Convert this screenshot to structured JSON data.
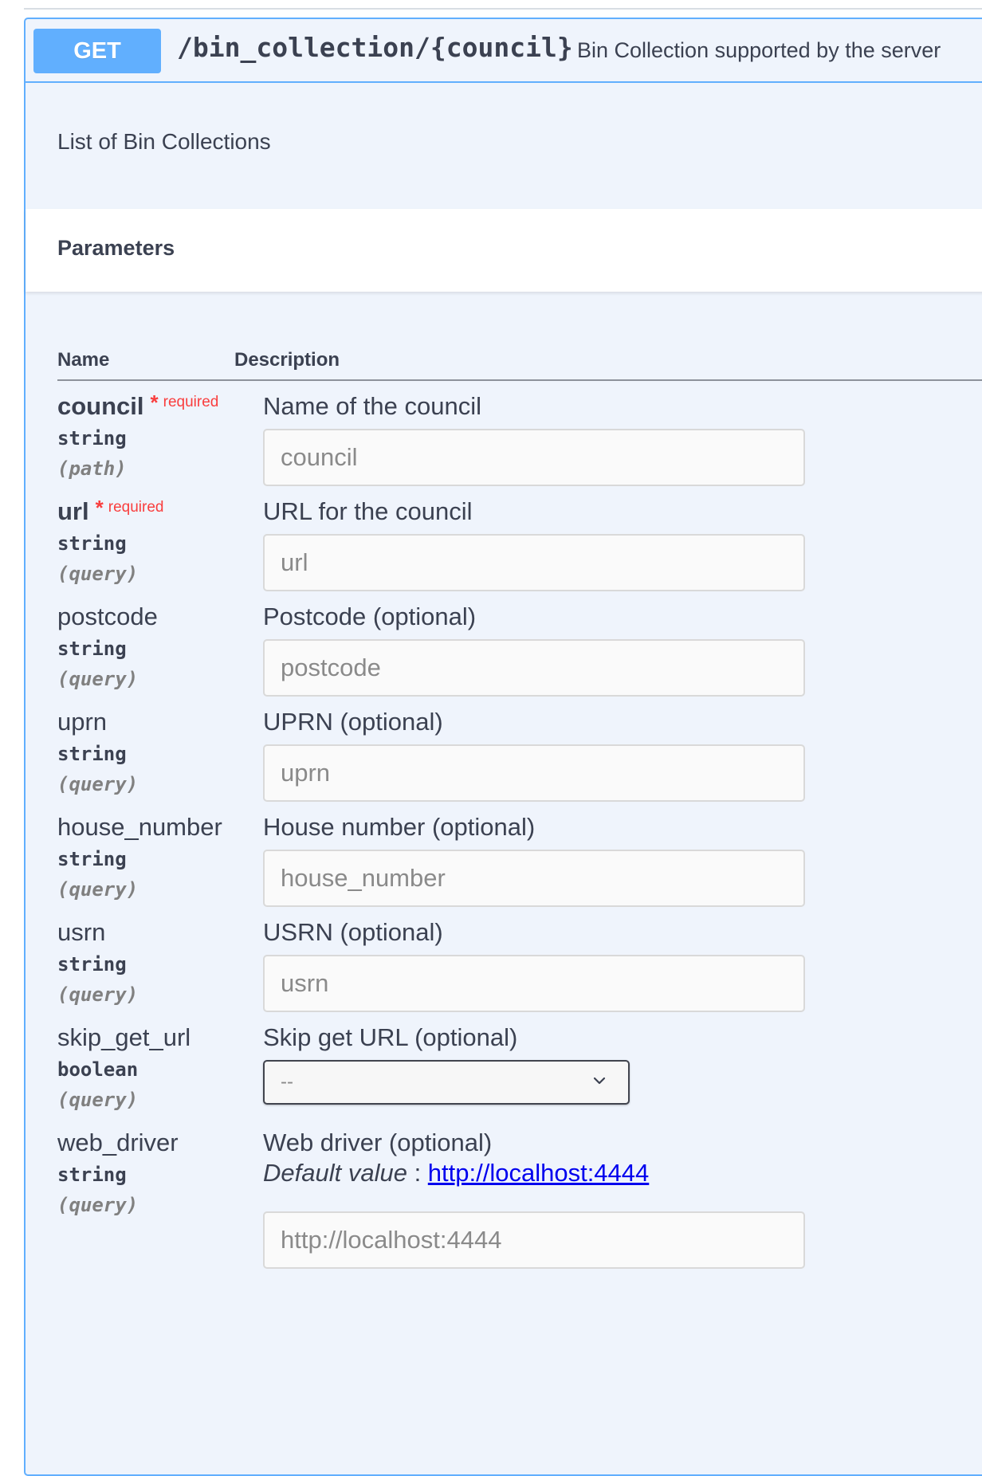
{
  "operation": {
    "method": "GET",
    "path": "/bin_collection/{council}",
    "summary": "Bin Collection supported by the server",
    "description": "List of Bin Collections"
  },
  "parameters_section": {
    "title": "Parameters",
    "col_name": "Name",
    "col_description": "Description"
  },
  "params": [
    {
      "name": "council",
      "required_label": "required",
      "type": "string",
      "in": "(path)",
      "description": "Name of the council",
      "placeholder": "council"
    },
    {
      "name": "url",
      "required_label": "required",
      "type": "string",
      "in": "(query)",
      "description": "URL for the council",
      "placeholder": "url"
    },
    {
      "name": "postcode",
      "type": "string",
      "in": "(query)",
      "description": "Postcode (optional)",
      "placeholder": "postcode"
    },
    {
      "name": "uprn",
      "type": "string",
      "in": "(query)",
      "description": "UPRN (optional)",
      "placeholder": "uprn"
    },
    {
      "name": "house_number",
      "type": "string",
      "in": "(query)",
      "description": "House number (optional)",
      "placeholder": "house_number"
    },
    {
      "name": "usrn",
      "type": "string",
      "in": "(query)",
      "description": "USRN (optional)",
      "placeholder": "usrn"
    },
    {
      "name": "skip_get_url",
      "type": "boolean",
      "in": "(query)",
      "description": "Skip get URL (optional)",
      "selected": "--"
    },
    {
      "name": "web_driver",
      "type": "string",
      "in": "(query)",
      "description": "Web driver (optional)",
      "default_label": "Default value",
      "default_sep": " : ",
      "default_value": "http://localhost:4444",
      "placeholder": "http://localhost:4444"
    }
  ],
  "icons": {
    "select_arrow": "chevron-down-icon"
  },
  "colors": {
    "get_method": "#61affe",
    "required": "#f93e3e",
    "block_bg": "#eff4fc"
  }
}
